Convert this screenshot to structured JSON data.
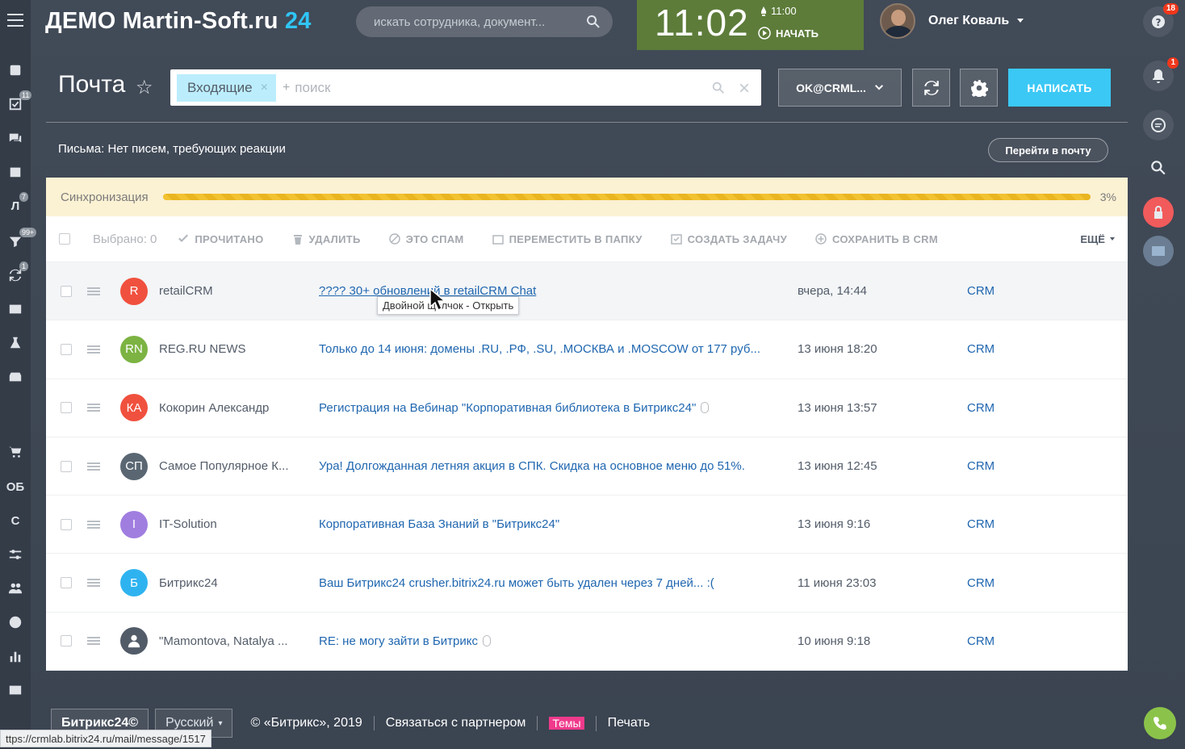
{
  "header": {
    "logo_main": "ДЕМО Martin-Soft.ru ",
    "logo_accent": "24",
    "search_placeholder": "искать сотрудника, документ...",
    "clock": "11:02",
    "alarm": "11:00",
    "start_label": "НАЧАТЬ",
    "user_name": "Олег Коваль"
  },
  "left_nav": {
    "badges": {
      "tasks": "11",
      "feed": "7",
      "filters": "99+",
      "sync": "1"
    },
    "letters": {
      "ob": "ОБ",
      "c": "С",
      "l": "Л"
    }
  },
  "right_nav": {
    "help_badge": "18",
    "bell_badge": "1"
  },
  "toolbar": {
    "page_title": "Почта",
    "filter_tag": "Входящие",
    "filter_plus": "+",
    "search_placeholder": "поиск",
    "mailbox": "OK@CRML...",
    "write_button": "НАПИСАТЬ"
  },
  "info": {
    "letters_status": "Письма: Нет писем, требующих реакции",
    "goto_mail": "Перейти в почту"
  },
  "sync": {
    "label": "Синхронизация",
    "percent_label": "3%",
    "progress": 0.03
  },
  "actions": {
    "selected": "Выбрано: 0",
    "read": "ПРОЧИТАНО",
    "delete": "УДАЛИТЬ",
    "spam": "ЭТО СПАМ",
    "move": "ПЕРЕМЕСТИТЬ В ПАПКУ",
    "task": "СОЗДАТЬ ЗАДАЧУ",
    "save_crm": "СОХРАНИТЬ В CRM",
    "more": "ЕЩЁ"
  },
  "messages": [
    {
      "initials": "R",
      "color": "#f0513e",
      "sender": "retailCRM",
      "subject": "???? 30+ обновлений в retailCRM Chat",
      "date": "вчера, 14:44",
      "crm": "CRM",
      "attachment": false
    },
    {
      "initials": "RN",
      "color": "#7cb342",
      "sender": "REG.RU NEWS",
      "subject": "Только до 14 июня: домены .RU, .РФ, .SU, .МОСКВА и .MOSCOW от 177 руб...",
      "date": "13 июня 18:20",
      "crm": "CRM",
      "attachment": false
    },
    {
      "initials": "КА",
      "color": "#f0513e",
      "sender": "Кокорин Александр",
      "subject": "Регистрация на Вебинар \"Корпоративная библиотека в Битрикс24\"",
      "date": "13 июня 13:57",
      "crm": "CRM",
      "attachment": true
    },
    {
      "initials": "СП",
      "color": "#5a6773",
      "sender": "Самое Популярное К...",
      "subject": "Ура! Долгожданная летняя акция в СПК. Скидка на основное меню до 51%.",
      "date": "13 июня 12:45",
      "crm": "CRM",
      "attachment": false
    },
    {
      "initials": "I",
      "color": "#a07ee0",
      "sender": "IT-Solution",
      "subject": "Корпоративная База Знаний в \"Битрикс24\"",
      "date": "13 июня 9:16",
      "crm": "CRM",
      "attachment": false
    },
    {
      "initials": "Б",
      "color": "#2fb3f0",
      "sender": "Битрикс24",
      "subject": "Ваш Битрикс24 crusher.bitrix24.ru может быть удален через 7 дней... :(",
      "date": "11 июня 23:03",
      "crm": "CRM",
      "attachment": false
    },
    {
      "initials": "",
      "color": "#525c68",
      "sender": "\"Mamontova, Natalya ...",
      "subject": "RE: не могу зайти в Битрикс",
      "date": "10 июня 9:18",
      "crm": "CRM",
      "attachment": true
    }
  ],
  "tooltip": "Двойной щелчок - Открыть",
  "footer": {
    "brand": "Битрикс24©",
    "language": "Русский",
    "copyright": "© «Битрикс», 2019",
    "partner": "Связаться с партнером",
    "themes": "Темы",
    "print": "Печать"
  },
  "status_url": "ttps://crmlab.bitrix24.ru/mail/message/1517"
}
